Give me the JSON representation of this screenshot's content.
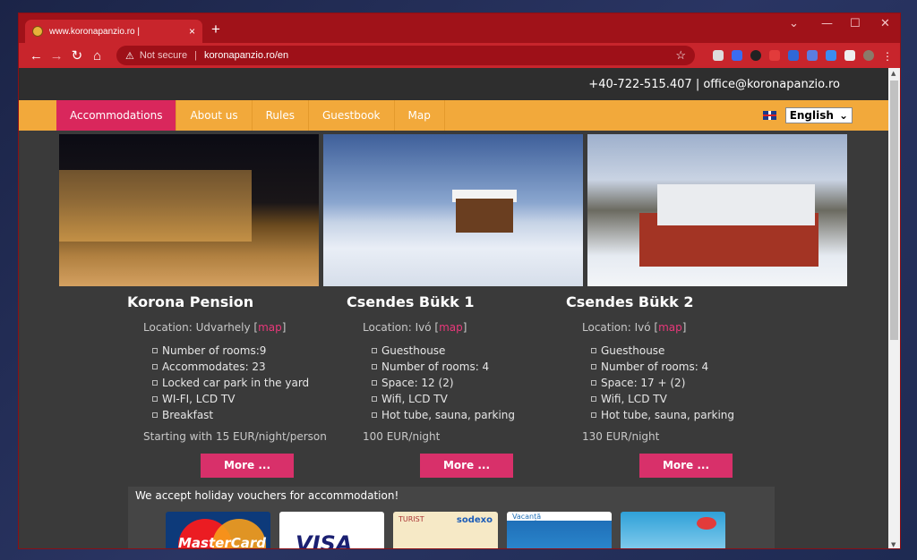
{
  "browser": {
    "tab_title": "www.koronapanzio.ro |",
    "tab_close": "×",
    "new_tab": "+",
    "security_label": "Not secure",
    "url": "koronapanzio.ro/en",
    "window_controls": [
      "⌄",
      "—",
      "☐",
      "✕"
    ]
  },
  "site": {
    "contact": "+40-722-515.407 | office@koronapanzio.ro",
    "nav": [
      "Accommodations",
      "About us",
      "Rules",
      "Guestbook",
      "Map"
    ],
    "language": "English",
    "pensions": [
      {
        "name": "Korona Pension",
        "location_prefix": "Location: Udvarhely [",
        "map": "map",
        "location_suffix": "]",
        "features": [
          "Number of rooms:9",
          "Accommodates: 23",
          "Locked car park in the yard",
          "WI-FI, LCD TV",
          "Breakfast"
        ],
        "price": "Starting with 15 EUR/night/person",
        "more": "More ..."
      },
      {
        "name": "Csendes Bükk 1",
        "location_prefix": "Location: Ivó [",
        "map": "map",
        "location_suffix": "]",
        "features": [
          "Guesthouse",
          "Number of rooms: 4",
          "Space: 12 (2)",
          "Wifi, LCD TV",
          "Hot tube, sauna, parking"
        ],
        "price": "100 EUR/night",
        "more": "More ..."
      },
      {
        "name": "Csendes Bükk 2",
        "location_prefix": "Location: Ivó [",
        "map": "map",
        "location_suffix": "]",
        "features": [
          "Guesthouse",
          "Number of rooms: 4",
          "Space: 17 + (2)",
          "Wifi, LCD TV",
          "Hot tube, sauna, parking"
        ],
        "price": "130 EUR/night",
        "more": "More ..."
      }
    ],
    "vouchers_text": "We accept holiday vouchers for accommodation!",
    "voucher_cards": {
      "mastercard": "MasterCard",
      "visa": "VISA",
      "turist": "TURIST",
      "sodexo": "sodexo",
      "vacanta": "Vacanță"
    }
  }
}
